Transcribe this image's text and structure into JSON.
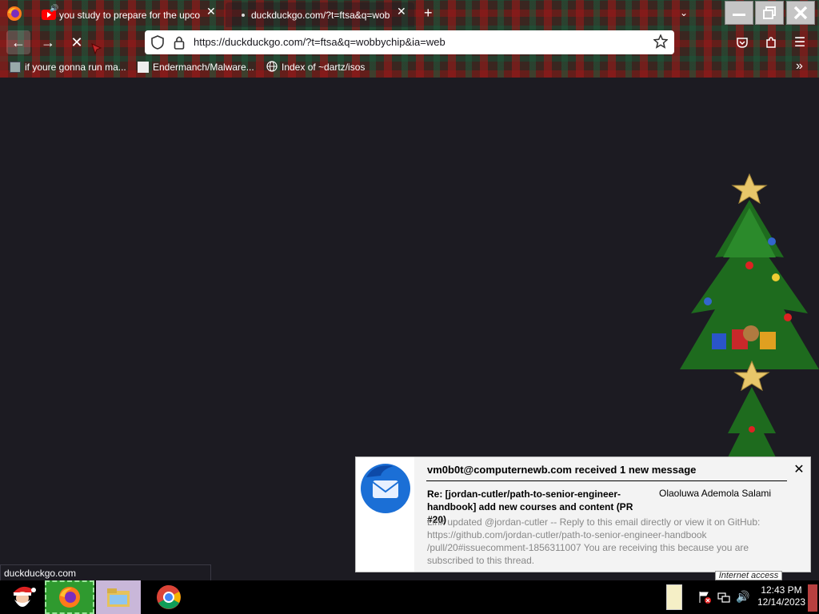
{
  "browser": {
    "tabs": [
      {
        "label": "you study to prepare for the upco",
        "audio_icon": "speaker-icon"
      },
      {
        "label": "duckduckgo.com/?t=ftsa&q=wob"
      }
    ],
    "new_tab": "+",
    "url": "https://duckduckgo.com/?t=ftsa&q=wobbychip&ia=web",
    "bookmarks": [
      {
        "label": "if youre gonna run ma..."
      },
      {
        "label": "Endermanch/Malware..."
      },
      {
        "label": "Index of ~dartz/isos"
      }
    ],
    "status_url": "duckduckgo.com"
  },
  "notification": {
    "title": "vm0b0t@computernewb.com received 1 new message",
    "subject": "Re: [jordan-cutler/path-to-senior-engineer-handbook] add new courses and content (PR #20)",
    "sender": "Olaoluwa Ademola Salami",
    "body": "Link updated @jordan-cutler -- Reply to this email directly or view it on GitHub: https://github.com/jordan-cutler/path-to-senior-engineer-handbook /pull/20#issuecomment-1856311007 You are receiving this because you are subscribed to this thread."
  },
  "tray": {
    "tooltip": "Internet access",
    "time": "12:43 PM",
    "date": "12/14/2023"
  },
  "colors": {
    "page_bg": "#1c1b22",
    "thunderbird_blue": "#1b6fd6",
    "firefox_orange": "#ff7a1a"
  }
}
